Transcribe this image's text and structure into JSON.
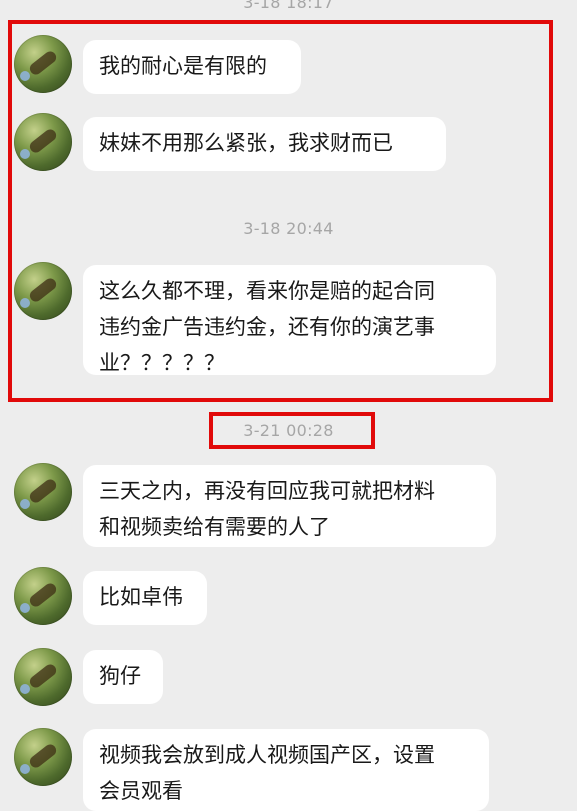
{
  "chat": {
    "timestamps": [
      "3-18 18:17",
      "3-18 20:44",
      "3-21 00:28"
    ],
    "messages": [
      {
        "text": "我的耐心是有限的"
      },
      {
        "text": "妹妹不用那么紧张，我求财而已"
      },
      {
        "text": "这么久都不理，看来你是赔的起合同\n违约金广告违约金，还有你的演艺事\n业？？？？？"
      },
      {
        "text": "三天之内，再没有回应我可就把材料\n和视频卖给有需要的人了"
      },
      {
        "text": "比如卓伟"
      },
      {
        "text": "狗仔"
      },
      {
        "text": "视频我会放到成人视频国产区，设置\n会员观看"
      }
    ]
  },
  "highlight_color": "#e10a0a"
}
